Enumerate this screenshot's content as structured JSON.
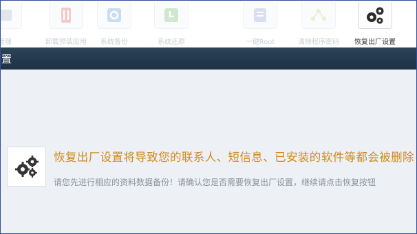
{
  "toolbar": {
    "items": [
      {
        "label": "管理",
        "icon": "tool-icon"
      },
      {
        "label": "卸载预装应用",
        "icon": "trash-icon"
      },
      {
        "label": "系统备份",
        "icon": "gear-icon"
      },
      {
        "label": "系统还原",
        "icon": "restore-icon"
      },
      {
        "label": "一键Root",
        "icon": "root-icon"
      },
      {
        "label": "清除程序密码",
        "icon": "unlock-icon"
      },
      {
        "label": "恢复出厂设置",
        "icon": "gears-icon",
        "active": true
      }
    ]
  },
  "page": {
    "title": "置"
  },
  "warning": {
    "icon": "gears-icon",
    "title": "恢复出厂设置将导致您的联系人、短信息、已安装的软件等都会被删除",
    "description": "请您先进行相应的资料数据备份！请确认您是否需要恢复出厂设置，继续请点击恢复按钮"
  },
  "colors": {
    "title_band": "#243a4e",
    "warning_title": "#d08a1c",
    "description": "#8c939c",
    "frame_border": "#2d4fa0"
  }
}
